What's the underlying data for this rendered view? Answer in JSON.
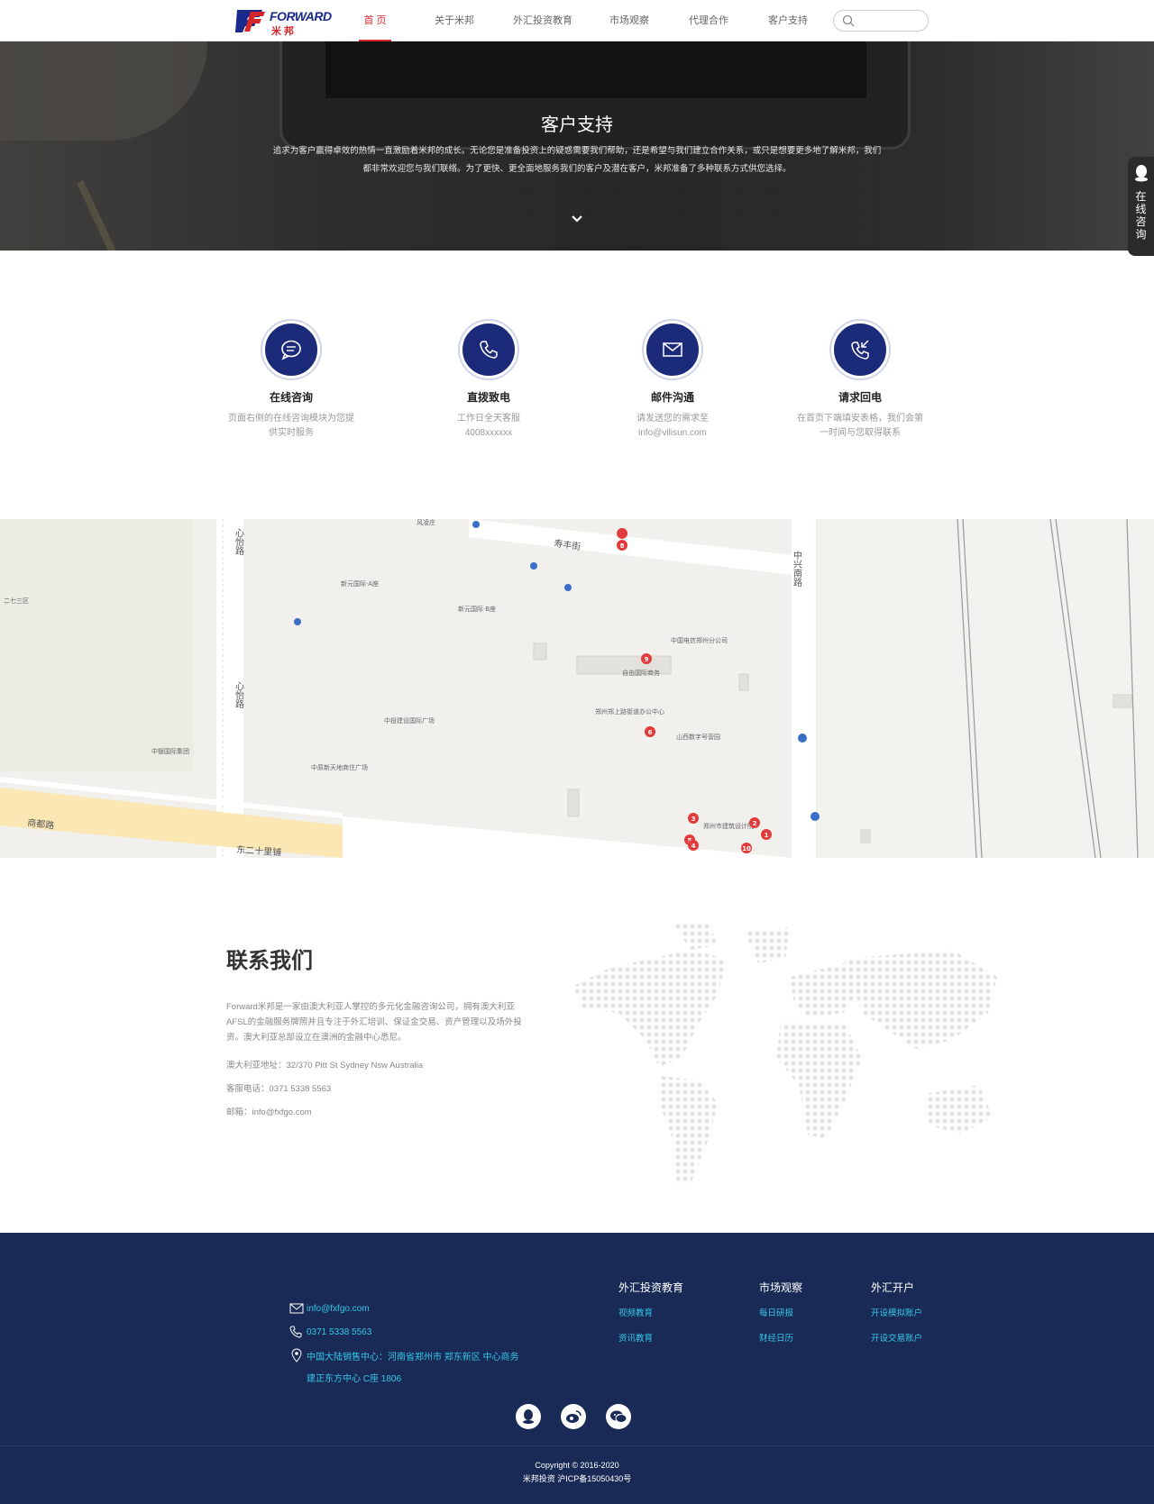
{
  "header": {
    "logo_word": "FORWARD",
    "logo_cn": "米邦",
    "nav": [
      {
        "label": "首  页",
        "active": true
      },
      {
        "label": "关于米邦",
        "active": false
      },
      {
        "label": "外汇投资教育",
        "active": false
      },
      {
        "label": "市场观察",
        "active": false
      },
      {
        "label": "代理合作",
        "active": false
      },
      {
        "label": "客户支持",
        "active": false
      }
    ],
    "search_placeholder": ""
  },
  "hero": {
    "title": "客户支持",
    "text": "追求为客户赢得卓效的热情一直激励着米邦的成长。无论您是准备投资上的疑惑需要我们帮助，还是希望与我们建立合作关系，或只是想要更多地了解米邦，我们都非常欢迎您与我们联络。为了更快、更全面地服务我们的客户及潜在客户，米邦准备了多种联系方式供您选择。"
  },
  "side_consult": {
    "label": "在线咨询"
  },
  "cards": [
    {
      "icon": "chat-icon",
      "title": "在线咨询",
      "desc1": "页面右侧的在线咨询模块为您提",
      "desc2": "供实时服务"
    },
    {
      "icon": "phone-icon",
      "title": "直拨致电",
      "desc1": "工作日全天客服",
      "desc2": "4008xxxxxx"
    },
    {
      "icon": "mail-icon",
      "title": "邮件沟通",
      "desc1": "请发送您的需求至",
      "desc2": "info@vilisun.com"
    },
    {
      "icon": "callback-icon",
      "title": "请求回电",
      "desc1": "在首页下端填安表格，我们会第",
      "desc2": "一时间与您取得联系"
    }
  ],
  "map": {
    "streets": [
      "心怡路",
      "寿丰街",
      "中兴南路",
      "商都路",
      "东二十里铺",
      "心怡路"
    ],
    "pois": [
      "风凌庄",
      "新元国际·A座",
      "新元国际·B座",
      "中国电信郑州分公司",
      "自由国际商务",
      "山西数字号营园",
      "中投建设国际广场",
      "中原新天地商住广场",
      "二七三区",
      "中银国际集团",
      "郑州郑上路街道办公中心",
      "郑州市建筑设计院"
    ],
    "markers": [
      "8",
      "9",
      "6",
      "3",
      "2",
      "1",
      "5",
      "4",
      "10"
    ]
  },
  "contact": {
    "title": "联系我们",
    "intro": "Forward米邦是一家由澳大利亚人掌控的多元化金融咨询公司，拥有澳大利亚AFSL的金融服务牌照并且专注于外汇培训、保证金交易、资产管理以及场外投资。澳大利亚总部设立在澳洲的金融中心悉尼。",
    "address": "澳大利亚地址：32/370 Pitt St Sydney Nsw Australia",
    "phone": "客服电话：0371 5338 5563",
    "email": "邮箱：info@fxfgo.com"
  },
  "footer": {
    "email": "info@fxfgo.com",
    "phone": "0371 5338 5563",
    "address1": "中国大陆销售中心：河南省郑州市 郑东新区 中心商务",
    "address2": "建正东方中心 C座 1806",
    "columns": [
      {
        "title": "外汇投资教育",
        "links": [
          "视频教育",
          "资讯教育"
        ]
      },
      {
        "title": "市场观察",
        "links": [
          "每日研报",
          "财经日历"
        ]
      },
      {
        "title": "外汇开户",
        "links": [
          "开设模拟账户",
          "开设交易账户"
        ]
      }
    ],
    "copyright": "Copyright © 2016-2020",
    "icp": "米邦投资 沪ICP备15050430号"
  },
  "colors": {
    "accent": "#d7262b",
    "brand_blue": "#1b2b7a",
    "footer_bg": "#182a55",
    "link_cyan": "#36c6e8"
  }
}
